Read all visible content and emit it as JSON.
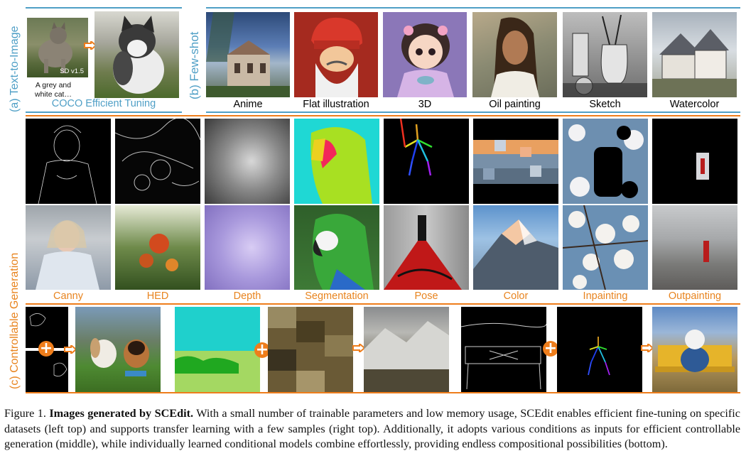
{
  "sections": {
    "a_label": "(a) Text-to-Image",
    "b_label": "(b) Few-shot",
    "c_label": "(c) Controllable Generation"
  },
  "text_to_image": {
    "badge": "SD v1.5",
    "prompt": "A grey and white cat…",
    "subtitle": "COCO Efficient Tuning"
  },
  "few_shot": {
    "styles": [
      "Anime",
      "Flat illustration",
      "3D",
      "Oil painting",
      "Sketch",
      "Watercolor"
    ]
  },
  "controllable": {
    "conditions": [
      "Canny",
      "HED",
      "Depth",
      "Segmentation",
      "Pose",
      "Color",
      "Inpainting",
      "Outpainting"
    ]
  },
  "caption": {
    "prefix": "Figure 1.",
    "title": "Images generated by SCEdit.",
    "body": "With a small number of trainable parameters and low memory usage, SCEdit enables efficient fine-tuning on specific datasets (left top) and supports transfer learning with a few samples (right top). Additionally, it adopts various conditions as inputs for efficient controllable generation (middle), while individually learned conditional models combine effortlessly, providing endless compositional possibilities (bottom)."
  },
  "colors": {
    "blue": "#4f9fc6",
    "orange": "#ee7d1b"
  }
}
